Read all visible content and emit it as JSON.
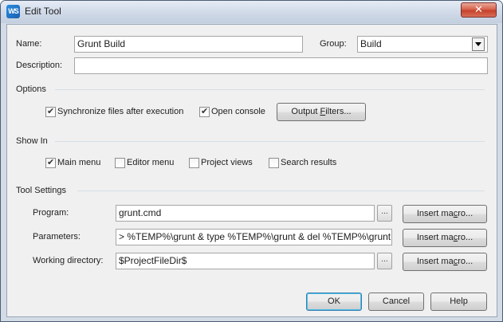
{
  "window": {
    "title": "Edit Tool",
    "close_glyph": "✕"
  },
  "app_icon": {
    "name": "webstorm-icon",
    "text": "WS"
  },
  "general": {
    "name_label": "Name:",
    "name_value": "Grunt Build",
    "group_label": "Group:",
    "group_value": "Build",
    "description_label": "Description:",
    "description_value": ""
  },
  "options": {
    "heading": "Options",
    "sync_label": "Synchronize files after execution",
    "sync_checked": true,
    "console_label": "Open console",
    "console_checked": true,
    "filters_button": {
      "before": "Output ",
      "mnemonic": "F",
      "after": "ilters..."
    }
  },
  "show_in": {
    "heading": "Show In",
    "items": [
      {
        "label": "Main menu",
        "checked": true
      },
      {
        "label": "Editor menu",
        "checked": false
      },
      {
        "label": "Project views",
        "checked": false
      },
      {
        "label": "Search results",
        "checked": false
      }
    ]
  },
  "tool_settings": {
    "heading": "Tool Settings",
    "program_label": "Program:",
    "program_value": "grunt.cmd",
    "parameters_label": "Parameters:",
    "parameters_value": "> %TEMP%\\grunt & type %TEMP%\\grunt & del %TEMP%\\grunt",
    "working_dir_label": "Working directory:",
    "working_dir_value": "$ProjectFileDir$",
    "browse_glyph": "...",
    "insert_macro": {
      "before": "Insert ma",
      "mnemonic": "c",
      "after": "ro..."
    }
  },
  "footer": {
    "ok_label": "OK",
    "cancel_label": "Cancel",
    "help_label": "Help"
  },
  "check_glyph": "✔"
}
